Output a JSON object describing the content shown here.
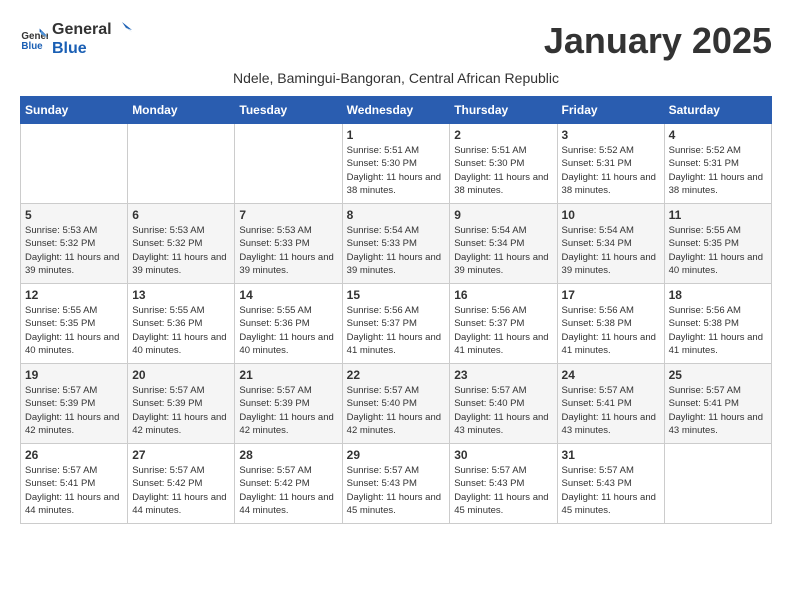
{
  "header": {
    "logo_general": "General",
    "logo_blue": "Blue",
    "month_year": "January 2025",
    "subtitle": "Ndele, Bamingui-Bangoran, Central African Republic"
  },
  "days_of_week": [
    "Sunday",
    "Monday",
    "Tuesday",
    "Wednesday",
    "Thursday",
    "Friday",
    "Saturday"
  ],
  "weeks": [
    [
      {
        "day": "",
        "info": ""
      },
      {
        "day": "",
        "info": ""
      },
      {
        "day": "",
        "info": ""
      },
      {
        "day": "1",
        "info": "Sunrise: 5:51 AM\nSunset: 5:30 PM\nDaylight: 11 hours and 38 minutes."
      },
      {
        "day": "2",
        "info": "Sunrise: 5:51 AM\nSunset: 5:30 PM\nDaylight: 11 hours and 38 minutes."
      },
      {
        "day": "3",
        "info": "Sunrise: 5:52 AM\nSunset: 5:31 PM\nDaylight: 11 hours and 38 minutes."
      },
      {
        "day": "4",
        "info": "Sunrise: 5:52 AM\nSunset: 5:31 PM\nDaylight: 11 hours and 38 minutes."
      }
    ],
    [
      {
        "day": "5",
        "info": "Sunrise: 5:53 AM\nSunset: 5:32 PM\nDaylight: 11 hours and 39 minutes."
      },
      {
        "day": "6",
        "info": "Sunrise: 5:53 AM\nSunset: 5:32 PM\nDaylight: 11 hours and 39 minutes."
      },
      {
        "day": "7",
        "info": "Sunrise: 5:53 AM\nSunset: 5:33 PM\nDaylight: 11 hours and 39 minutes."
      },
      {
        "day": "8",
        "info": "Sunrise: 5:54 AM\nSunset: 5:33 PM\nDaylight: 11 hours and 39 minutes."
      },
      {
        "day": "9",
        "info": "Sunrise: 5:54 AM\nSunset: 5:34 PM\nDaylight: 11 hours and 39 minutes."
      },
      {
        "day": "10",
        "info": "Sunrise: 5:54 AM\nSunset: 5:34 PM\nDaylight: 11 hours and 39 minutes."
      },
      {
        "day": "11",
        "info": "Sunrise: 5:55 AM\nSunset: 5:35 PM\nDaylight: 11 hours and 40 minutes."
      }
    ],
    [
      {
        "day": "12",
        "info": "Sunrise: 5:55 AM\nSunset: 5:35 PM\nDaylight: 11 hours and 40 minutes."
      },
      {
        "day": "13",
        "info": "Sunrise: 5:55 AM\nSunset: 5:36 PM\nDaylight: 11 hours and 40 minutes."
      },
      {
        "day": "14",
        "info": "Sunrise: 5:55 AM\nSunset: 5:36 PM\nDaylight: 11 hours and 40 minutes."
      },
      {
        "day": "15",
        "info": "Sunrise: 5:56 AM\nSunset: 5:37 PM\nDaylight: 11 hours and 41 minutes."
      },
      {
        "day": "16",
        "info": "Sunrise: 5:56 AM\nSunset: 5:37 PM\nDaylight: 11 hours and 41 minutes."
      },
      {
        "day": "17",
        "info": "Sunrise: 5:56 AM\nSunset: 5:38 PM\nDaylight: 11 hours and 41 minutes."
      },
      {
        "day": "18",
        "info": "Sunrise: 5:56 AM\nSunset: 5:38 PM\nDaylight: 11 hours and 41 minutes."
      }
    ],
    [
      {
        "day": "19",
        "info": "Sunrise: 5:57 AM\nSunset: 5:39 PM\nDaylight: 11 hours and 42 minutes."
      },
      {
        "day": "20",
        "info": "Sunrise: 5:57 AM\nSunset: 5:39 PM\nDaylight: 11 hours and 42 minutes."
      },
      {
        "day": "21",
        "info": "Sunrise: 5:57 AM\nSunset: 5:39 PM\nDaylight: 11 hours and 42 minutes."
      },
      {
        "day": "22",
        "info": "Sunrise: 5:57 AM\nSunset: 5:40 PM\nDaylight: 11 hours and 42 minutes."
      },
      {
        "day": "23",
        "info": "Sunrise: 5:57 AM\nSunset: 5:40 PM\nDaylight: 11 hours and 43 minutes."
      },
      {
        "day": "24",
        "info": "Sunrise: 5:57 AM\nSunset: 5:41 PM\nDaylight: 11 hours and 43 minutes."
      },
      {
        "day": "25",
        "info": "Sunrise: 5:57 AM\nSunset: 5:41 PM\nDaylight: 11 hours and 43 minutes."
      }
    ],
    [
      {
        "day": "26",
        "info": "Sunrise: 5:57 AM\nSunset: 5:41 PM\nDaylight: 11 hours and 44 minutes."
      },
      {
        "day": "27",
        "info": "Sunrise: 5:57 AM\nSunset: 5:42 PM\nDaylight: 11 hours and 44 minutes."
      },
      {
        "day": "28",
        "info": "Sunrise: 5:57 AM\nSunset: 5:42 PM\nDaylight: 11 hours and 44 minutes."
      },
      {
        "day": "29",
        "info": "Sunrise: 5:57 AM\nSunset: 5:43 PM\nDaylight: 11 hours and 45 minutes."
      },
      {
        "day": "30",
        "info": "Sunrise: 5:57 AM\nSunset: 5:43 PM\nDaylight: 11 hours and 45 minutes."
      },
      {
        "day": "31",
        "info": "Sunrise: 5:57 AM\nSunset: 5:43 PM\nDaylight: 11 hours and 45 minutes."
      },
      {
        "day": "",
        "info": ""
      }
    ]
  ]
}
